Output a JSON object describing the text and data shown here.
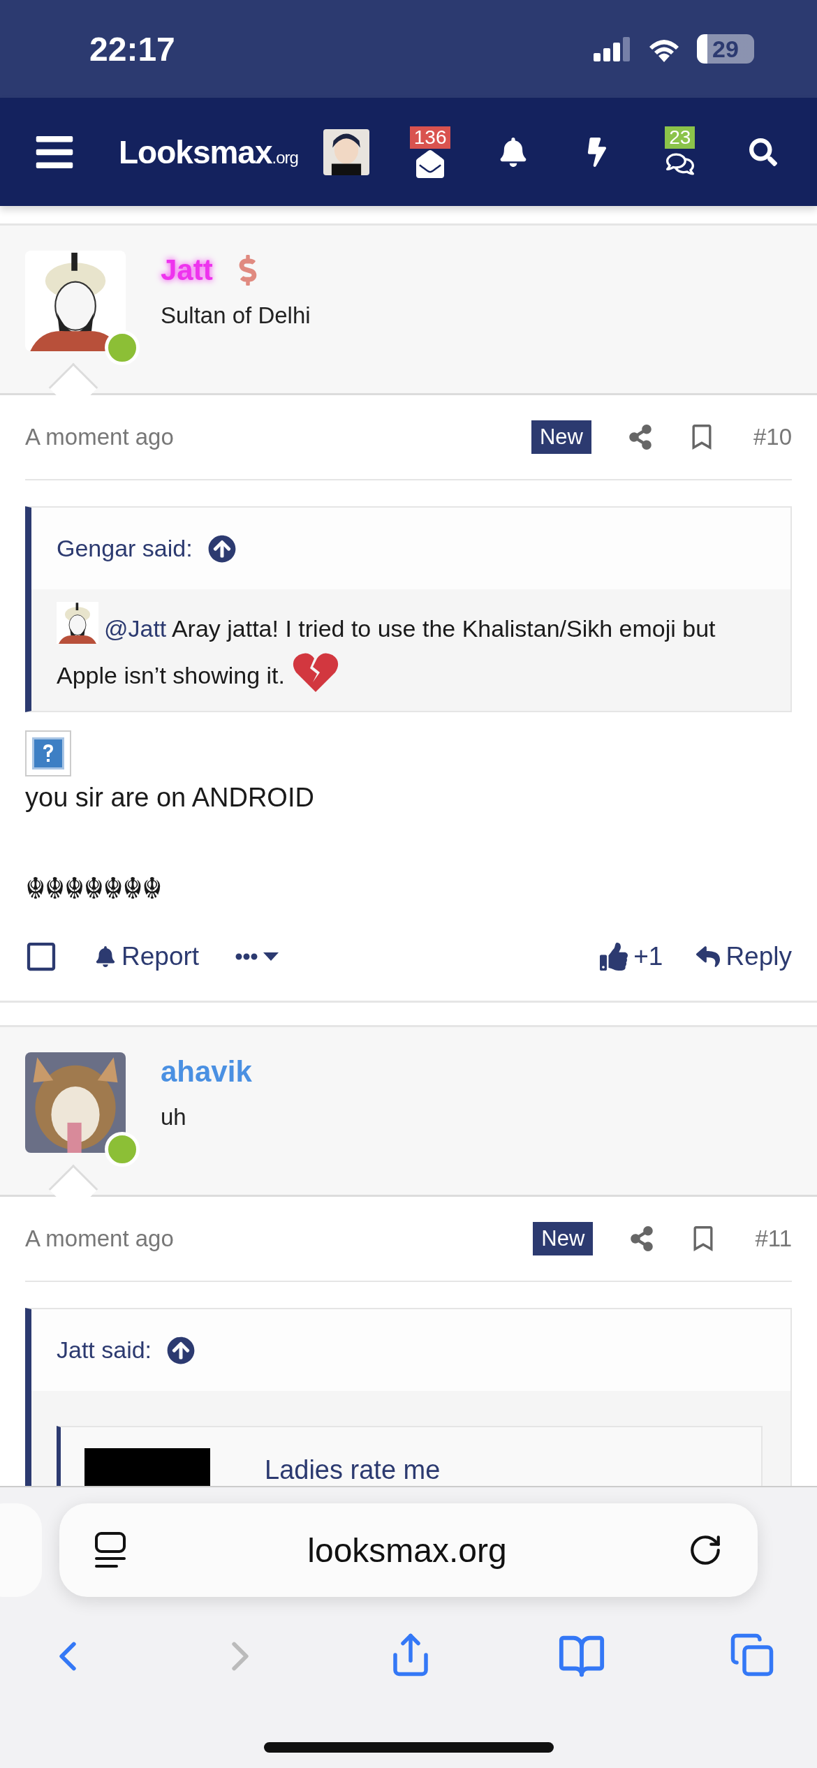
{
  "status_bar": {
    "time": "22:17",
    "battery": "29"
  },
  "nav": {
    "logo": "Looksmax",
    "logo_suffix": ".org",
    "items": [
      {
        "kind": "avatar"
      },
      {
        "kind": "inbox",
        "badge": "136",
        "color": "#d9534f"
      },
      {
        "kind": "alerts"
      },
      {
        "kind": "whats_new"
      },
      {
        "kind": "conversations",
        "badge": "23",
        "color": "#8bc34a"
      },
      {
        "kind": "search"
      }
    ]
  },
  "posts": [
    {
      "user": {
        "name": "Jatt",
        "color": "#ee33ee",
        "glow": true,
        "donor": true,
        "title": "Sultan of Delhi",
        "online": true
      },
      "time": "A moment ago",
      "badge": "New",
      "number": "#10",
      "quote": {
        "author": "Gengar said:",
        "mention": "@Jatt",
        "text": "Aray jatta! I tried to use the Khalistan/Sikh emoji but Apple isn’t showing it.",
        "broken_heart": true
      },
      "missing_image": true,
      "lines": [
        "you sir are on ANDROID",
        "☬☬☬☬☬☬☬"
      ],
      "actions": {
        "selected": false,
        "report": "Report",
        "reaction": "+1",
        "reply": "Reply"
      }
    },
    {
      "user": {
        "name": "ahavik",
        "color": "#4a90e2",
        "glow": false,
        "donor": false,
        "title": "uh",
        "online": true
      },
      "time": "A moment ago",
      "badge": "New",
      "number": "#11",
      "quote": {
        "author": "Jatt said:",
        "nested_title": "Ladies rate me"
      }
    }
  ],
  "browser": {
    "url": "looksmax.org"
  }
}
